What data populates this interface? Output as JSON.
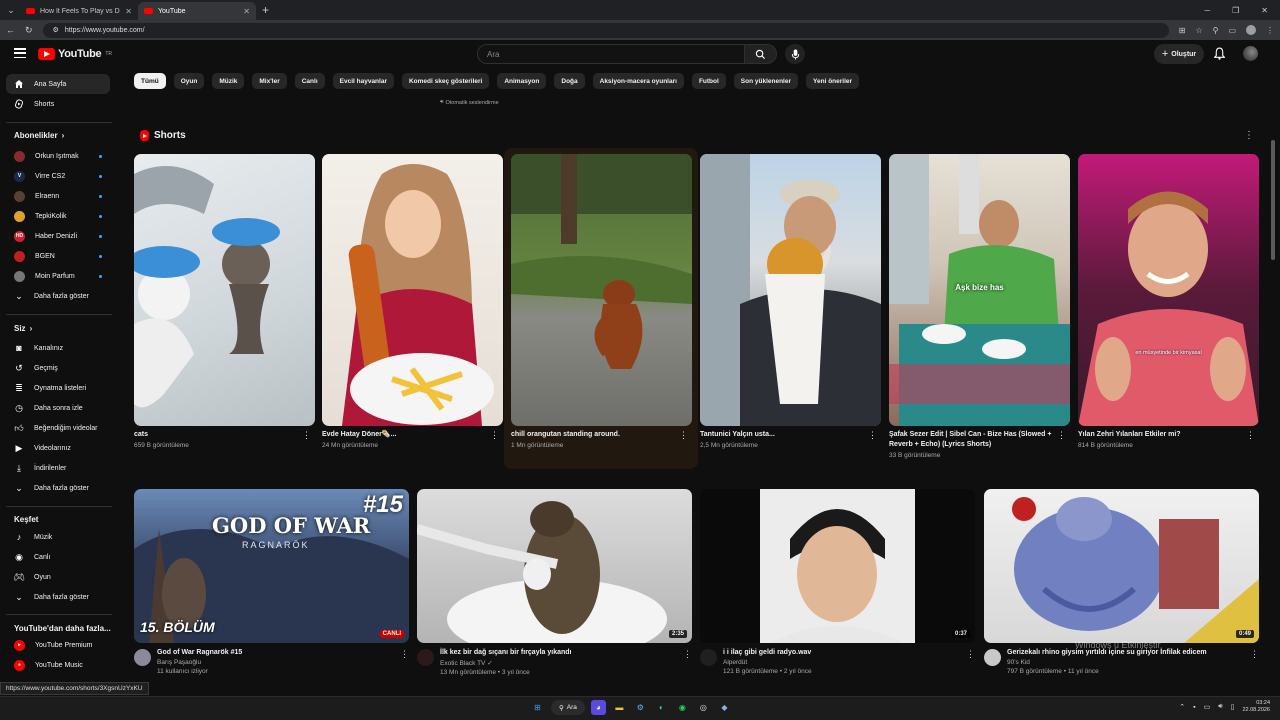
{
  "browser": {
    "tabs": [
      {
        "title": "How It Feels To Play vs DONK in F"
      },
      {
        "title": "YouTube"
      }
    ],
    "url": "https://www.youtube.com/",
    "status_url": "https://www.youtube.com/shorts/3XgsnUzYxKU"
  },
  "header": {
    "logo_text": "YouTube",
    "logo_suffix": "TR",
    "search_placeholder": "Ara",
    "create_label": "Oluştur"
  },
  "sidebar": {
    "main": [
      {
        "label": "Ana Sayfa",
        "icon": "home-icon"
      },
      {
        "label": "Shorts",
        "icon": "shorts-icon"
      }
    ],
    "subs_heading": "Abonelikler",
    "subscriptions": [
      {
        "label": "Orkun Işıtmak",
        "color": "#8a2a2a"
      },
      {
        "label": "Virre CS2",
        "color": "#1c2a4a"
      },
      {
        "label": "Elraenn",
        "color": "#5a4030"
      },
      {
        "label": "TepkiKolik",
        "color": "#e0a030"
      },
      {
        "label": "Haber Denizli",
        "color": "#d02030"
      },
      {
        "label": "BGEN",
        "color": "#c02020"
      },
      {
        "label": "Moin Parfum",
        "color": "#777777"
      }
    ],
    "subs_more": "Daha fazla göster",
    "you_heading": "Siz",
    "you_items": [
      {
        "label": "Kanalınız",
        "icon": "channel-icon"
      },
      {
        "label": "Geçmiş",
        "icon": "history-icon"
      },
      {
        "label": "Oynatma listeleri",
        "icon": "playlist-icon"
      },
      {
        "label": "Daha sonra izle",
        "icon": "clock-icon"
      },
      {
        "label": "Beğendiğim videolar",
        "icon": "like-icon"
      },
      {
        "label": "Videolarınız",
        "icon": "video-icon"
      },
      {
        "label": "İndirilenler",
        "icon": "download-icon"
      }
    ],
    "you_more": "Daha fazla göster",
    "explore_heading": "Keşfet",
    "explore_items": [
      {
        "label": "Müzik",
        "icon": "music-icon"
      },
      {
        "label": "Canlı",
        "icon": "live-icon"
      },
      {
        "label": "Oyun",
        "icon": "gaming-icon"
      }
    ],
    "explore_more": "Daha fazla göster",
    "more_heading": "YouTube'dan daha fazla...",
    "more_items": [
      {
        "label": "YouTube Premium"
      },
      {
        "label": "YouTube Music"
      }
    ]
  },
  "chips": [
    "Tümü",
    "Oyun",
    "Müzik",
    "Mix'ler",
    "Canlı",
    "Evcil hayvanlar",
    "Komedi skeç gösterileri",
    "Animasyon",
    "Doğa",
    "Aksiyon-macera oyunları",
    "Futbol",
    "Son yüklenenler",
    "Yeni öneriler"
  ],
  "auto_dub": "Otomatik seslendirme",
  "shorts": {
    "heading": "Shorts",
    "items": [
      {
        "title": "cats",
        "views": "659 B görüntüleme"
      },
      {
        "title": "Evde Hatay Döner🌯...",
        "views": "24 Mn görüntüleme"
      },
      {
        "title": "chill orangutan standing around.",
        "views": "1 Mn görüntüleme"
      },
      {
        "title": "Tantunici Yalçın usta...",
        "views": "2,5 Mn görüntüleme"
      },
      {
        "title": "Şafak Sezer Edit | Sibel Can - Bize Has (Slowed + Reverb + Echo) (Lyrics Shorts)",
        "views": "33 B görüntüleme",
        "overlay": "Aşk bize has"
      },
      {
        "title": "Yılan Zehri Yılanları Etkiler mi?",
        "views": "814 B görüntüleme",
        "overlay": "en müsyetinde bir kimyasal"
      }
    ]
  },
  "videos": [
    {
      "title": "God of War Ragnarök #15",
      "channel": "Barış Paşaoğlu",
      "stats": "11 kullanıcı izliyor",
      "badge": "CANLI",
      "thumb_title": "GOD OF WAR",
      "thumb_sub": "RAGNARÖK",
      "thumb_num": "#15",
      "thumb_ep": "15. BÖLÜM"
    },
    {
      "title": "İlk kez bir dağ sıçanı bir fırçayla yıkandı",
      "channel": "Exotic Black TV ✓",
      "stats": "13 Mn görüntüleme • 3 yıl önce",
      "duration": "2:35"
    },
    {
      "title": "i i ilaç gibi geldi radyo.wav",
      "channel": "Alperdüt",
      "stats": "121 B görüntüleme • 2 yıl önce",
      "duration": "0:37"
    },
    {
      "title": "Gerizekalı rhino giysim yırtıldı içine su giriyor İnfilak edicem",
      "channel": "90's Kid",
      "stats": "797 B görüntüleme • 11 yıl önce",
      "duration": "0:49"
    }
  ],
  "watermark": "Windows u Etkinleştir",
  "taskbar": {
    "search_label": "Ara",
    "time": "03:24",
    "date": "22.08.2026"
  }
}
